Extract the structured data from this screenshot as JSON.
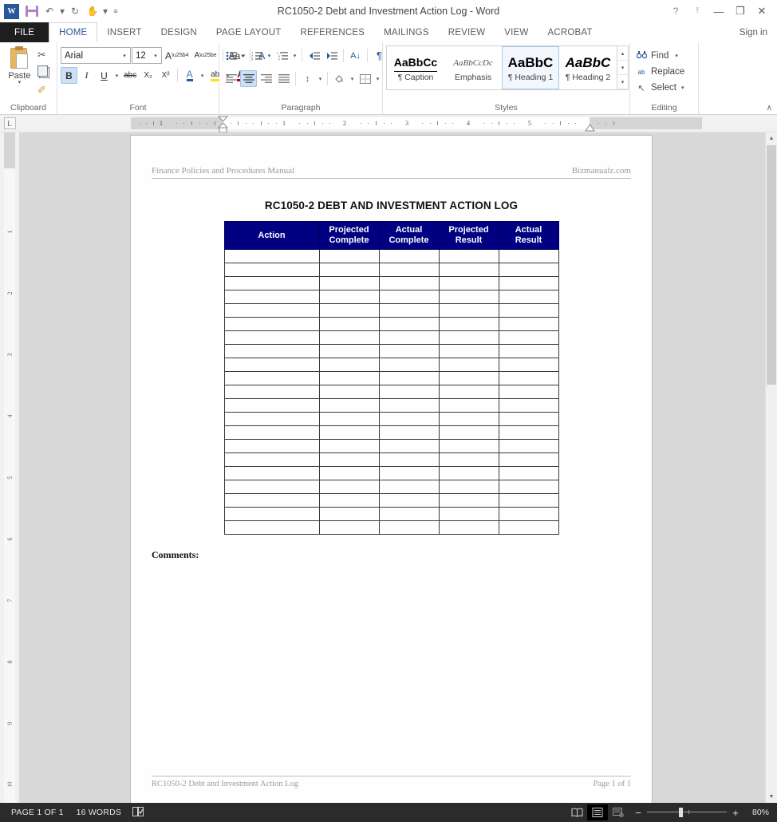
{
  "window": {
    "title": "RC1050-2 Debt and Investment Action Log - Word",
    "quick_access": [
      {
        "name": "word-logo",
        "label": "W"
      },
      {
        "name": "save-icon",
        "label": ""
      },
      {
        "name": "undo-icon",
        "label": "↶"
      },
      {
        "name": "undo-caret",
        "label": "▾"
      },
      {
        "name": "redo-icon",
        "label": "↻"
      },
      {
        "name": "touch-mode-icon",
        "label": "✋"
      },
      {
        "name": "touch-caret",
        "label": "▾"
      },
      {
        "name": "customize-qat-icon",
        "label": "≡"
      }
    ],
    "controls": {
      "help": "?",
      "ribbon_display": "⤒",
      "minimize": "—",
      "restore": "❐",
      "close": "✕"
    }
  },
  "ribbon": {
    "tabs": [
      {
        "label": "FILE",
        "type": "file"
      },
      {
        "label": "HOME",
        "active": true
      },
      {
        "label": "INSERT"
      },
      {
        "label": "DESIGN"
      },
      {
        "label": "PAGE LAYOUT"
      },
      {
        "label": "REFERENCES"
      },
      {
        "label": "MAILINGS"
      },
      {
        "label": "REVIEW"
      },
      {
        "label": "VIEW"
      },
      {
        "label": "ACROBAT"
      }
    ],
    "sign_in": "Sign in",
    "clipboard": {
      "group_label": "Clipboard",
      "paste_label": "Paste",
      "paste_caret": "▾",
      "cut_icon": "✂",
      "copy_icon": "copy",
      "format_painter_icon": "✐",
      "dialog_launcher": "↘"
    },
    "font": {
      "group_label": "Font",
      "font_name": "Arial",
      "font_size": "12",
      "grow_font": "A",
      "shrink_font": "A",
      "change_case": "Aa",
      "clear_formatting": "A",
      "bold": "B",
      "italic": "I",
      "underline": "U",
      "strikethrough": "abc",
      "subscript": "X₂",
      "superscript": "X²",
      "text_effects": "A",
      "highlight": "ab",
      "font_color": "A",
      "caret": "▾",
      "dialog_launcher": "↘"
    },
    "paragraph": {
      "group_label": "Paragraph",
      "bullets": "≡",
      "numbering": "≡",
      "multilevel": "≡",
      "decrease_indent": "⇤",
      "increase_indent": "⇥",
      "sort": "A↓",
      "show_marks": "¶",
      "align_left": "≡",
      "align_center": "≡",
      "align_right": "≡",
      "justify": "≡",
      "line_spacing": "↕",
      "shading": "■",
      "borders": "⊞",
      "caret": "▾",
      "dialog_launcher": "↘"
    },
    "styles": {
      "group_label": "Styles",
      "items": [
        {
          "preview": "AaBbCc",
          "name": "¶ Caption",
          "kind": "caption"
        },
        {
          "preview": "AaBbCcDc",
          "name": "Emphasis",
          "kind": "emphasis"
        },
        {
          "preview": "AaBbC",
          "name": "¶ Heading 1",
          "kind": "h1",
          "selected": true
        },
        {
          "preview": "AaBbC",
          "name": "¶ Heading 2",
          "kind": "h2"
        }
      ],
      "scroll_up": "▴",
      "scroll_down": "▾",
      "more": "▾",
      "dialog_launcher": "↘"
    },
    "editing": {
      "group_label": "Editing",
      "find": "Find",
      "find_caret": "▾",
      "replace": "Replace",
      "select": "Select",
      "select_caret": "▾",
      "find_icon": "🔍",
      "replace_icon": "ab",
      "select_icon": "↖"
    },
    "collapse": "∧"
  },
  "ruler": {
    "tab_stop_marker": "L",
    "horizontal_numbers": [
      "1",
      "1",
      "2",
      "3",
      "4",
      "5"
    ],
    "vertical_numbers": [
      "1",
      "2",
      "3",
      "4",
      "5",
      "6",
      "7",
      "8",
      "9",
      "10"
    ]
  },
  "document": {
    "header_left": "Finance Policies and Procedures Manual",
    "header_right": "Bizmanualz.com",
    "title": "RC1050-2 DEBT AND INVESTMENT ACTION LOG",
    "table": {
      "columns": [
        "Action",
        "Projected\nComplete",
        "Actual\nComplete",
        "Projected\nResult",
        "Actual\nResult"
      ],
      "columns_display": [
        {
          "line1": "Action",
          "line2": ""
        },
        {
          "line1": "Projected",
          "line2": "Complete"
        },
        {
          "line1": "Actual",
          "line2": "Complete"
        },
        {
          "line1": "Projected",
          "line2": "Result"
        },
        {
          "line1": "Actual",
          "line2": "Result"
        }
      ],
      "empty_row_count": 21,
      "header_bg": "#000080",
      "header_color": "#FFFFFF",
      "border_color": "#3A3A3A"
    },
    "comments_label": "Comments:",
    "footer_left": "RC1050-2 Debt and Investment Action Log",
    "footer_right": "Page 1 of 1"
  },
  "status_bar": {
    "page_indicator": "PAGE 1 OF 1",
    "word_count": "16 WORDS",
    "proofing_icon": "📖",
    "views": [
      {
        "name": "read-mode",
        "icon": "📖",
        "active": false
      },
      {
        "name": "print-layout",
        "icon": "☰",
        "active": true
      },
      {
        "name": "web-layout",
        "icon": "☷",
        "active": false
      }
    ],
    "zoom_out": "−",
    "zoom_in": "+",
    "zoom_level": "80%"
  }
}
